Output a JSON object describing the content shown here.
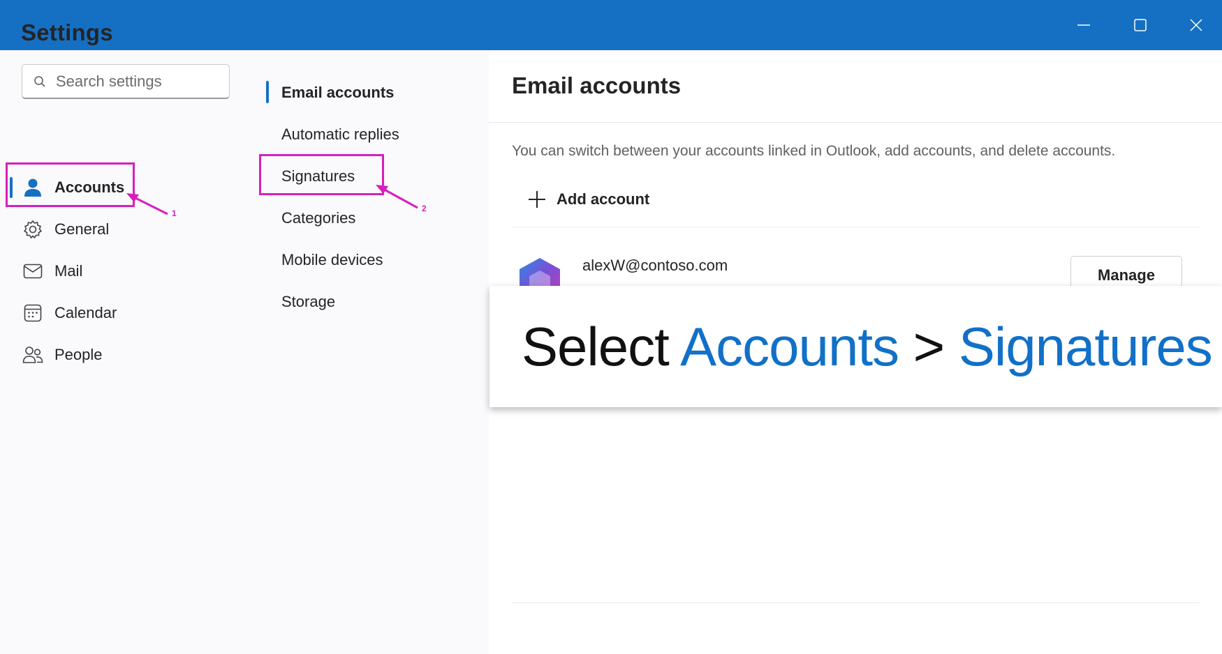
{
  "window": {
    "controls": {
      "minimize_icon": "minimize-icon",
      "maximize_icon": "maximize-icon",
      "close_icon": "close-icon"
    },
    "titlebar_color": "#1570c3"
  },
  "settings_nav": {
    "title": "Settings",
    "search": {
      "placeholder": "Search settings",
      "value": ""
    },
    "items": [
      {
        "label": "Accounts",
        "icon": "person-icon",
        "active": true
      },
      {
        "label": "General",
        "icon": "gear-icon",
        "active": false
      },
      {
        "label": "Mail",
        "icon": "mail-icon",
        "active": false
      },
      {
        "label": "Calendar",
        "icon": "calendar-icon",
        "active": false
      },
      {
        "label": "People",
        "icon": "people-icon",
        "active": false
      }
    ]
  },
  "accounts_subnav": {
    "items": [
      {
        "label": "Email accounts",
        "active": true
      },
      {
        "label": "Automatic replies",
        "active": false
      },
      {
        "label": "Signatures",
        "active": false
      },
      {
        "label": "Categories",
        "active": false
      },
      {
        "label": "Mobile devices",
        "active": false
      },
      {
        "label": "Storage",
        "active": false
      }
    ]
  },
  "main": {
    "heading": "Email accounts",
    "description": "You can switch between your accounts linked in Outlook, add accounts, and delete accounts.",
    "add_account_label": "Add account",
    "account": {
      "email": "alexW@contoso.com",
      "icon": "microsoft-365-icon",
      "manage_label": "Manage"
    }
  },
  "caption": {
    "prefix": "Select ",
    "step1": "Accounts",
    "separator": " > ",
    "step2": "Signatures",
    "highlight_color": "#1170c8"
  },
  "annotations": {
    "step1_number": "1",
    "step2_number": "2",
    "color": "#d61fbd"
  }
}
